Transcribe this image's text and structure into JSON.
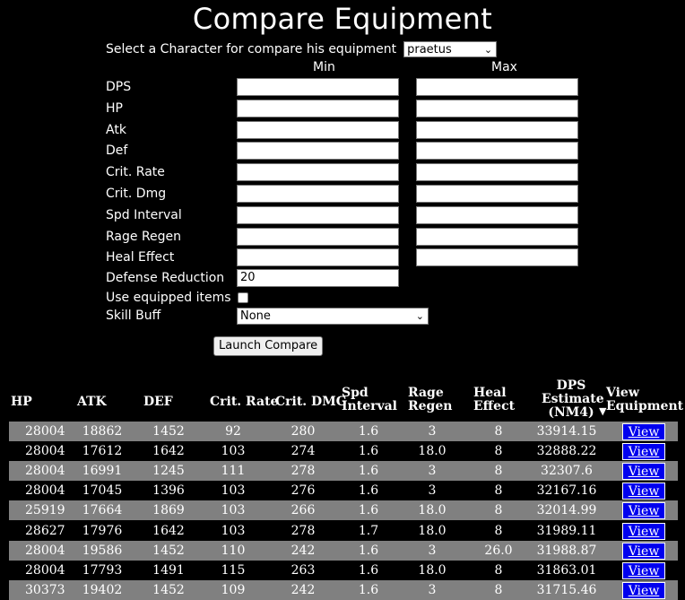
{
  "page": {
    "title": "Compare Equipment",
    "select_label": "Select a Character for compare his equipment",
    "character": "praetus",
    "min_label": "Min",
    "max_label": "Max"
  },
  "form": {
    "fields": [
      {
        "label": "DPS",
        "min": "",
        "max": ""
      },
      {
        "label": "HP",
        "min": "",
        "max": ""
      },
      {
        "label": "Atk",
        "min": "",
        "max": ""
      },
      {
        "label": "Def",
        "min": "",
        "max": ""
      },
      {
        "label": "Crit. Rate",
        "min": "",
        "max": ""
      },
      {
        "label": "Crit. Dmg",
        "min": "",
        "max": ""
      },
      {
        "label": "Spd Interval",
        "min": "",
        "max": ""
      },
      {
        "label": "Rage Regen",
        "min": "",
        "max": ""
      },
      {
        "label": "Heal Effect",
        "min": "",
        "max": ""
      }
    ],
    "defense_reduction_label": "Defense Reduction",
    "defense_reduction_value": "20",
    "use_equipped_label": "Use equipped items",
    "use_equipped_checked": false,
    "skill_buff_label": "Skill Buff",
    "skill_buff_value": "None",
    "launch_label": "Launch Compare"
  },
  "table": {
    "headers": {
      "hp": "HP",
      "atk": "ATK",
      "def": "DEF",
      "crit_rate": "Crit. Rate",
      "crit_dmg": "Crit. DMG",
      "spd_1": "Spd",
      "spd_2": "Interval",
      "rage_1": "Rage",
      "rage_2": "Regen",
      "heal_1": "Heal",
      "heal_2": "Effect",
      "dps_1": "DPS",
      "dps_2": "Estimate",
      "dps_3": "(NM4)",
      "view_1": "View",
      "view_2": "Equipment"
    },
    "sort_arrow": "▼",
    "view_label": "View",
    "rows": [
      {
        "hp": "28004",
        "atk": "18862",
        "def": "1452",
        "crit_rate": "92",
        "crit_dmg": "280",
        "spd": "1.6",
        "rage": "3",
        "heal": "8",
        "dps": "33914.15"
      },
      {
        "hp": "28004",
        "atk": "17612",
        "def": "1642",
        "crit_rate": "103",
        "crit_dmg": "274",
        "spd": "1.6",
        "rage": "18.0",
        "heal": "8",
        "dps": "32888.22"
      },
      {
        "hp": "28004",
        "atk": "16991",
        "def": "1245",
        "crit_rate": "111",
        "crit_dmg": "278",
        "spd": "1.6",
        "rage": "3",
        "heal": "8",
        "dps": "32307.6"
      },
      {
        "hp": "28004",
        "atk": "17045",
        "def": "1396",
        "crit_rate": "103",
        "crit_dmg": "276",
        "spd": "1.6",
        "rage": "3",
        "heal": "8",
        "dps": "32167.16"
      },
      {
        "hp": "25919",
        "atk": "17664",
        "def": "1869",
        "crit_rate": "103",
        "crit_dmg": "266",
        "spd": "1.6",
        "rage": "18.0",
        "heal": "8",
        "dps": "32014.99"
      },
      {
        "hp": "28627",
        "atk": "17976",
        "def": "1642",
        "crit_rate": "103",
        "crit_dmg": "278",
        "spd": "1.7",
        "rage": "18.0",
        "heal": "8",
        "dps": "31989.11"
      },
      {
        "hp": "28004",
        "atk": "19586",
        "def": "1452",
        "crit_rate": "110",
        "crit_dmg": "242",
        "spd": "1.6",
        "rage": "3",
        "heal": "26.0",
        "dps": "31988.87"
      },
      {
        "hp": "28004",
        "atk": "17793",
        "def": "1491",
        "crit_rate": "115",
        "crit_dmg": "263",
        "spd": "1.6",
        "rage": "18.0",
        "heal": "8",
        "dps": "31863.01"
      },
      {
        "hp": "30373",
        "atk": "19402",
        "def": "1452",
        "crit_rate": "109",
        "crit_dmg": "242",
        "spd": "1.6",
        "rage": "3",
        "heal": "8",
        "dps": "31715.46"
      }
    ]
  }
}
